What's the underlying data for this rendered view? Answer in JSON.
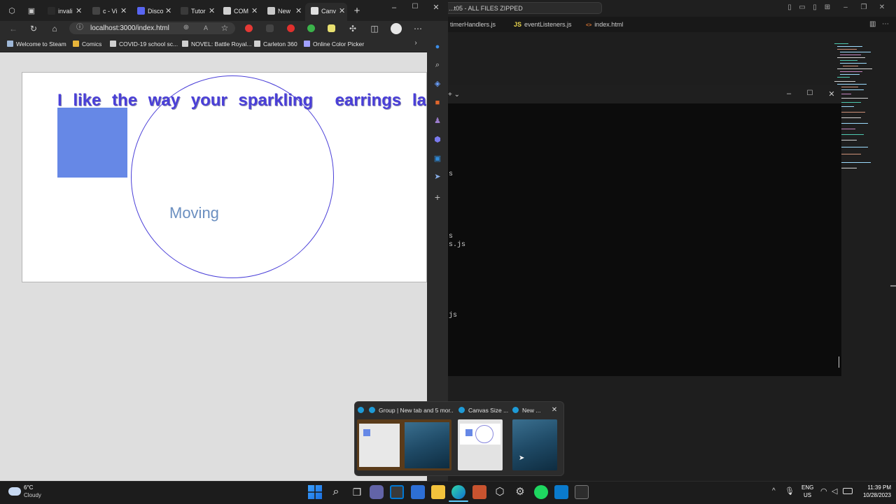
{
  "vscode": {
    "command_center": "...t05 - ALL FILES ZIPPED",
    "tabs": [
      {
        "icon": "",
        "label": "timerHandlers.js"
      },
      {
        "icon": "JS",
        "label": "eventListeners.js"
      },
      {
        "icon": "<>",
        "label": "index.html"
      }
    ]
  },
  "terminal": {
    "tab_controls": "+ ⌄",
    "lines": [
      {
        "text": "s"
      },
      {
        "text": "s"
      },
      {
        "text": "s.js"
      },
      {
        "text": "js"
      }
    ]
  },
  "browser": {
    "tabs": [
      {
        "label": "invali",
        "icon_color": "#2b2b2b"
      },
      {
        "label": "c - Vi",
        "icon_color": "#444444"
      },
      {
        "label": "Disco",
        "icon_color": "#5865f2"
      },
      {
        "label": "Tutor",
        "icon_color": "#3a3a3a"
      },
      {
        "label": "COM",
        "icon_color": "#d0d0d0"
      },
      {
        "label": "New",
        "icon_color": "#c8c8c8"
      },
      {
        "label": "Canv",
        "icon_color": "#e0e0e0"
      }
    ],
    "address": "localhost:3000/index.html",
    "bookmarks": [
      {
        "label": "Welcome to Steam",
        "icon_color": "#9fb8d8"
      },
      {
        "label": "Comics",
        "icon_color": "#e8b53a"
      },
      {
        "label": "COVID-19 school sc...",
        "icon_color": "#d0d0d0"
      },
      {
        "label": "NOVEL: Battle Royal...",
        "icon_color": "#d0d0d0"
      },
      {
        "label": "Carleton 360",
        "icon_color": "#d0d0d0"
      },
      {
        "label": "Online Color Picker",
        "icon_color": "#a0a0ff"
      }
    ],
    "canvas": {
      "text": "I like the way your sparkling  earrings lay",
      "moving_text": "Moving",
      "rect_color": "#6688e6",
      "stroke_color": "#4a3fd8"
    }
  },
  "popup": {
    "items": [
      {
        "title": "Group | New tab and 5 mor..."
      },
      {
        "title": "Canvas Size ..."
      },
      {
        "title": "New ..."
      }
    ]
  },
  "taskbar": {
    "weather_temp": "6°C",
    "weather_desc": "Cloudy",
    "lang": "ENG",
    "region": "US",
    "time": "11:39 PM",
    "date": "10/28/2023"
  }
}
